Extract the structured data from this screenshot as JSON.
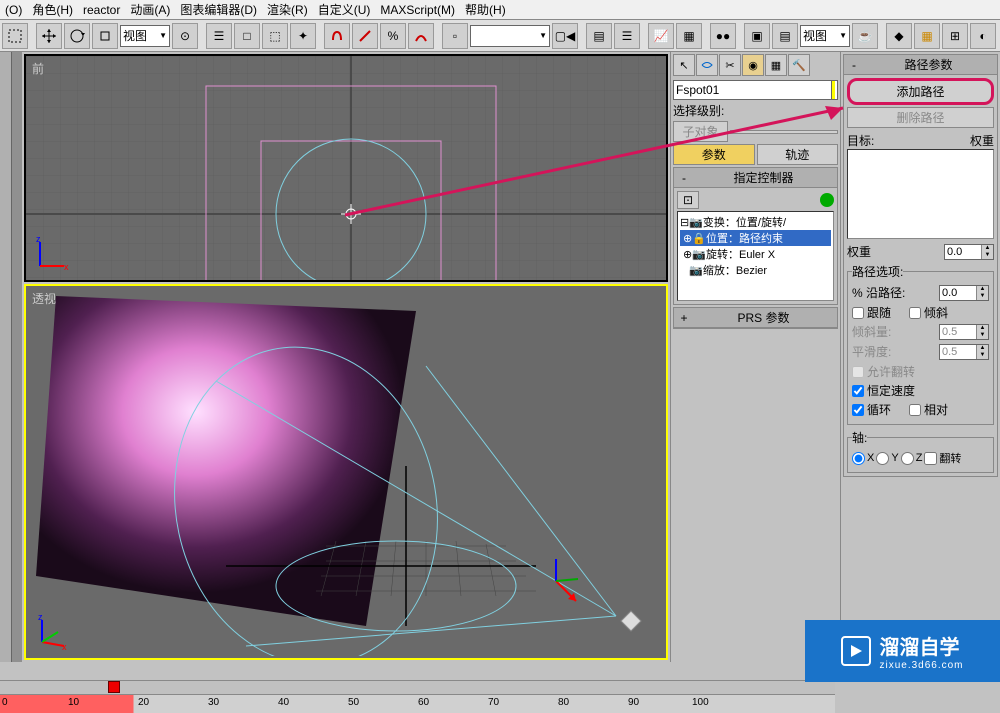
{
  "menu": {
    "items": [
      "(O)",
      "角色(H)",
      "reactor",
      "动画(A)",
      "图表编辑器(D)",
      "渲染(R)",
      "自定义(U)",
      "MAXScript(M)",
      "帮助(H)"
    ]
  },
  "toolbar": {
    "dropdown1": "视图",
    "dropdown2": "视图"
  },
  "viewports": {
    "top_label": "前",
    "bottom_label": "透视"
  },
  "cmd": {
    "object_name": "Fspot01",
    "select_level_label": "选择级别:",
    "sub_object_btn": "子对象",
    "params_btn": "参数",
    "track_btn": "轨迹",
    "assign_controller_title": "指定控制器",
    "tree": {
      "transform": "变换：位置/旋转/",
      "position": "位置：路径约束",
      "rotation": "旋转：Euler X",
      "scale": "缩放：Bezier"
    },
    "prs_title": "PRS 参数"
  },
  "params": {
    "rollup_title": "路径参数",
    "add_path": "添加路径",
    "delete_path": "删除路径",
    "target_label": "目标:",
    "weight_header": "权重",
    "weight_label": "权重",
    "weight_val": "0.0",
    "path_options": "路径选项:",
    "percent_along": "% 沿路径:",
    "percent_val": "0.0",
    "follow": "跟随",
    "bank": "倾斜",
    "bank_amount": "倾斜量:",
    "bank_amount_val": "0.5",
    "smoothness": "平滑度:",
    "smoothness_val": "0.5",
    "allow_flip": "允许翻转",
    "constant_vel": "恒定速度",
    "loop": "循环",
    "relative": "相对",
    "axis_label": "轴:",
    "axis_x": "X",
    "axis_y": "Y",
    "axis_z": "Z",
    "flip": "翻转"
  },
  "timeline": {
    "ticks": [
      "0",
      "10",
      "20",
      "30",
      "40",
      "50",
      "60",
      "70",
      "80",
      "90",
      "100"
    ]
  },
  "watermark": {
    "title": "溜溜自学",
    "url": "zixue.3d66.com"
  }
}
